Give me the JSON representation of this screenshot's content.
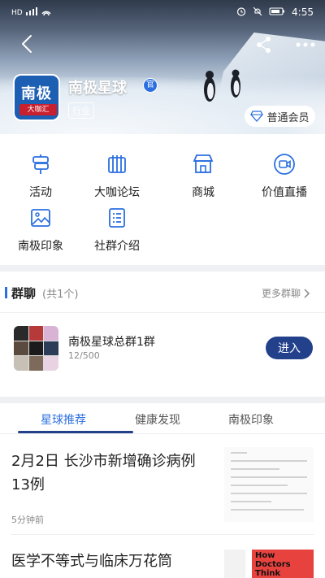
{
  "status_bar": {
    "left": "HD ⁴⁶ ᵢₗₗ",
    "time": "4:55"
  },
  "header": {
    "title": "南极星球",
    "verified_badge": "官",
    "tag": "行业",
    "member_label": "普通会员",
    "logo_text": "南极",
    "logo_sub": "大咖汇",
    "back_icon": "chevron-left-icon",
    "share_icon": "share-icon",
    "more_icon": "more-icon"
  },
  "menu": {
    "items": [
      {
        "label": "活动",
        "icon": "signpost-icon"
      },
      {
        "label": "大咖论坛",
        "icon": "forum-icon"
      },
      {
        "label": "商城",
        "icon": "shop-icon"
      },
      {
        "label": "价值直播",
        "icon": "video-icon"
      },
      {
        "label": "南极印象",
        "icon": "image-icon"
      },
      {
        "label": "社群介绍",
        "icon": "list-icon"
      }
    ]
  },
  "group_chat": {
    "title": "群聊",
    "count": "(共1个)",
    "more": "更多群聊",
    "group": {
      "name": "南极星球总群1群",
      "members": "12/500",
      "enter": "进入"
    }
  },
  "tabs": {
    "items": [
      "星球推荐",
      "健康发现",
      "南极印象"
    ],
    "active": "星球推荐"
  },
  "articles": [
    {
      "title_line1": "2月2日 长沙市新增确诊病例",
      "title_line2": "13例",
      "time": "5分钟前"
    },
    {
      "title_line1": "医学不等式与临床万花筒",
      "thumb_text": "How Doctors Think"
    }
  ],
  "colors": {
    "accent": "#2b6fe0",
    "button": "#23418b",
    "divider": "#eef0f3"
  }
}
